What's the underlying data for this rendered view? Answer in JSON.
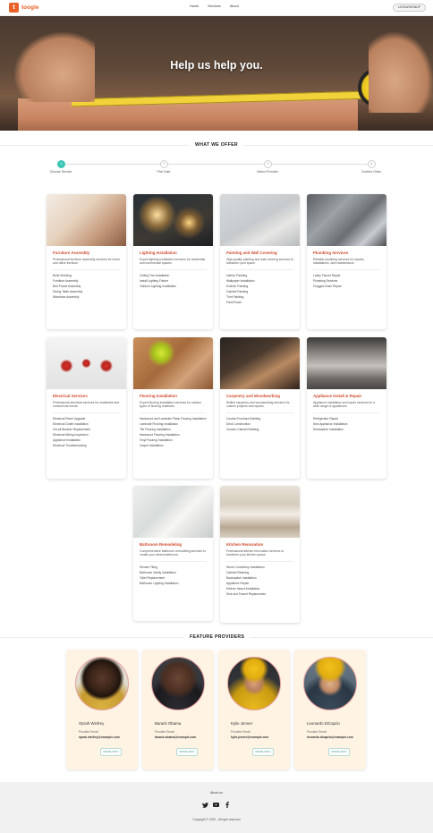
{
  "header": {
    "logo_letter": "t",
    "logo_text": "toogle",
    "nav": [
      "Home",
      "Services",
      "About"
    ],
    "login_label": "LOGIN/SIGNUP"
  },
  "hero": {
    "title": "Help us help you."
  },
  "offer": {
    "title": "WHAT WE OFFER",
    "steps": [
      {
        "num": "1",
        "label": "Choose Service"
      },
      {
        "num": "2",
        "label": "Pick Date"
      },
      {
        "num": "3",
        "label": "Select Provider"
      },
      {
        "num": "4",
        "label": "Confirm Order"
      }
    ]
  },
  "services": [
    {
      "title": "Furniture Assembly",
      "desc": "Professional furniture assembly services for home and office furniture.",
      "items": [
        "Build Shelving",
        "Furniture Assembly",
        "Bed Frame Assembly",
        "Dining Table Assembly",
        "Wardrobe Assembly"
      ]
    },
    {
      "title": "Lighting Installation",
      "desc": "Expert lighting installation services for residential and commercial spaces.",
      "items": [
        "Ceiling Fan Installation",
        "Install Lighting Fixture",
        "Outdoor Lighting Installation"
      ]
    },
    {
      "title": "Painting and Wall Covering",
      "desc": "High-quality painting and wall covering services to transform your space.",
      "items": [
        "Interior Painting",
        "Wallpaper Installation",
        "Exterior Painting",
        "Cabinet Painting",
        "Trim Painting",
        "Paint Room"
      ]
    },
    {
      "title": "Plumbing Services",
      "desc": "Reliable plumbing services for repairs, installations, and maintenance.",
      "items": [
        "Leaky Faucet Repair",
        "Plumbing Services",
        "Clogged Drain Repair"
      ]
    },
    {
      "title": "Electrical Services",
      "desc": "Professional electrical services for residential and commercial needs.",
      "items": [
        "Electrical Panel Upgrade",
        "Electrical Outlet Installation",
        "Circuit Breaker Replacement",
        "Electrical Wiring Inspection",
        "Appliance Installation",
        "Electrical Troubleshooting"
      ]
    },
    {
      "title": "Flooring Installation",
      "desc": "Expert flooring installation services for various types of flooring materials.",
      "items": [
        "Hardwood and Laminate Plank Flooring Installation",
        "Laminate Flooring Installation",
        "Tile Flooring Installation",
        "Hardwood Flooring Installation",
        "Vinyl Flooring Installation",
        "Carpet Installation"
      ]
    },
    {
      "title": "Carpentry and Woodworking",
      "desc": "Skilled carpentry and woodworking services for custom projects and repairs.",
      "items": [
        "Custom Furniture Building",
        "Deck Construction",
        "Custom Cabinet Building"
      ]
    },
    {
      "title": "Appliance Install & Repair",
      "desc": "Appliance installation and repair services for a wide range of appliances.",
      "items": [
        "Refrigerator Repair",
        "New Appliance Installation",
        "Dishwasher Installation"
      ]
    },
    {
      "title": "Bathroom Remodeling",
      "desc": "Comprehensive bathroom remodeling services to create your dream bathroom.",
      "items": [
        "Shower Tiling",
        "Bathroom Vanity Installation",
        "Toilet Replacement",
        "Bathroom Lighting Installation"
      ]
    },
    {
      "title": "Kitchen Renovation",
      "desc": "Professional kitchen renovation services to transform your kitchen space.",
      "items": [
        "Stone Countertop Installation",
        "Cabinet Refacing",
        "Backsplash Installation",
        "Appliance Repair",
        "Kitchen Island Installation",
        "Sink and Faucet Replacement"
      ]
    }
  ],
  "providers": {
    "title": "FEATURE PROVIDERS",
    "email_label": "Provider Email:",
    "more_label": "MORE INFO",
    "list": [
      {
        "name": "Oprah Winfrey",
        "email": "oprah.winfrey@example.com"
      },
      {
        "name": "Barack Obama",
        "email": "barack.obama@example.com"
      },
      {
        "name": "Kylie Jenner",
        "email": "kylie.jenner@example.com"
      },
      {
        "name": "Leonardo DiCaprio",
        "email": "leonardo.dicaprio@example.com"
      }
    ]
  },
  "footer": {
    "about": "About us",
    "copyright": "Copyright © 2023 - All right reserved"
  },
  "colors": {
    "brand": "#e8632a",
    "accent": "#3cc6b3",
    "card_title": "#d0492a"
  }
}
